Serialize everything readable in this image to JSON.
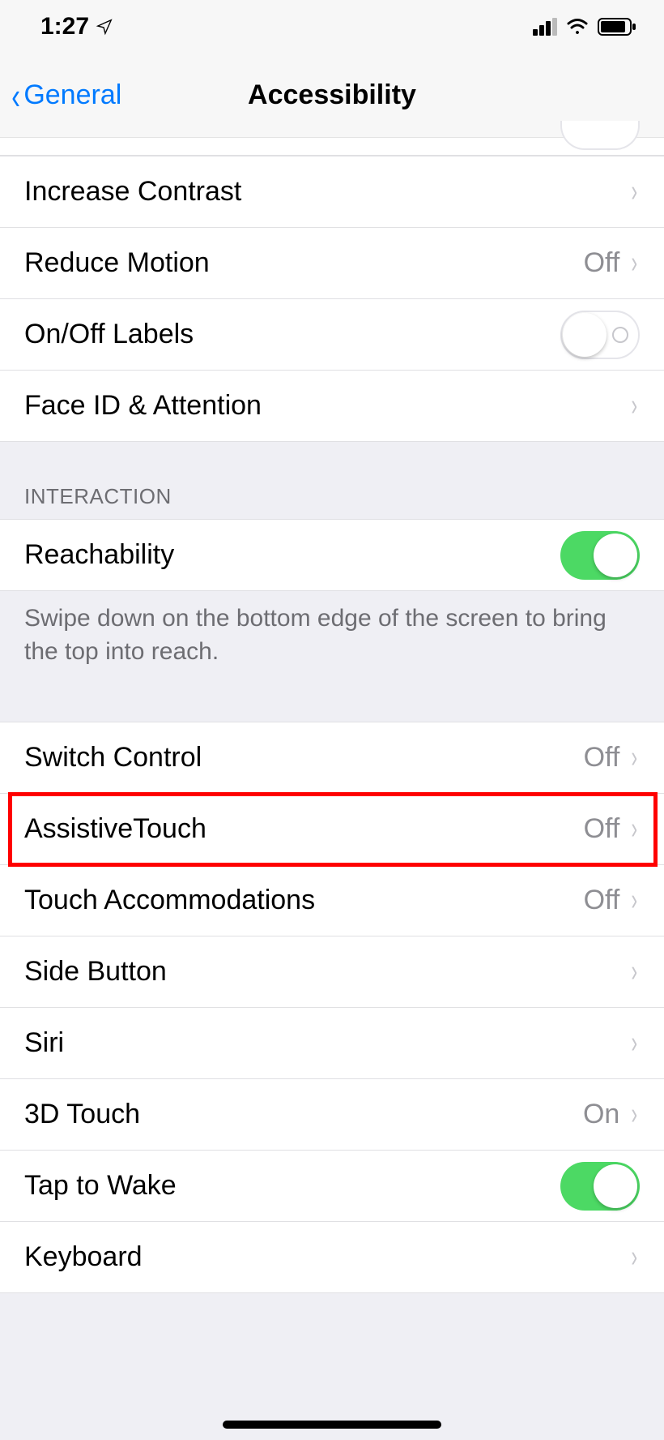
{
  "statusBar": {
    "time": "1:27"
  },
  "nav": {
    "back": "General",
    "title": "Accessibility"
  },
  "section1": {
    "increaseContrast": {
      "label": "Increase Contrast"
    },
    "reduceMotion": {
      "label": "Reduce Motion",
      "value": "Off"
    },
    "onOffLabels": {
      "label": "On/Off Labels",
      "toggle": false
    },
    "faceId": {
      "label": "Face ID & Attention"
    }
  },
  "section2": {
    "header": "INTERACTION",
    "reachability": {
      "label": "Reachability",
      "toggle": true
    },
    "footer": "Swipe down on the bottom edge of the screen to bring the top into reach."
  },
  "section3": {
    "switchControl": {
      "label": "Switch Control",
      "value": "Off"
    },
    "assistiveTouch": {
      "label": "AssistiveTouch",
      "value": "Off"
    },
    "touchAccommodations": {
      "label": "Touch Accommodations",
      "value": "Off"
    },
    "sideButton": {
      "label": "Side Button"
    },
    "siri": {
      "label": "Siri"
    },
    "threeDTouch": {
      "label": "3D Touch",
      "value": "On"
    },
    "tapToWake": {
      "label": "Tap to Wake",
      "toggle": true
    },
    "keyboard": {
      "label": "Keyboard"
    }
  }
}
